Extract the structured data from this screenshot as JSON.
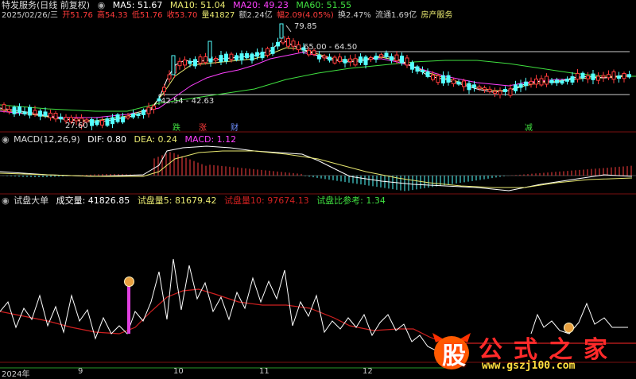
{
  "header": {
    "line1": {
      "title": "特发服务(日线 前复权)",
      "ma5": "MA5: 51.67",
      "ma10": "MA10: 51.04",
      "ma20": "MA20: 49.23",
      "ma60": "MA60: 51.55"
    },
    "line2": {
      "date": "2025/02/26/三",
      "open": "开51.76",
      "high": "高54.33",
      "low": "低51.76",
      "close": "收53.70",
      "volume": "量41827",
      "amount": "额2.24亿",
      "amplitude": "幅2.09(4.05%)",
      "turnover": "换2.47%",
      "float": "流通1.69亿",
      "sector": "房产服务"
    }
  },
  "price_panel": {
    "annotations": {
      "high_label": "79.85",
      "range_label": "65.00 - 64.50",
      "mid_label": "42.54 - 42.63",
      "low_label": "27.60"
    },
    "tags": {
      "tag1": "跌",
      "tag2": "涨",
      "tag3": "财",
      "tag4": "减"
    }
  },
  "macd_panel": {
    "title": "MACD(12,26,9)",
    "dif": "DIF: 0.80",
    "dea": "DEA: 0.24",
    "macd": "MACD: 1.12"
  },
  "indicator_panel": {
    "title": "试盘大单",
    "volume": "成交量: 41826.85",
    "test5": "试盘量5: 81679.42",
    "test10": "试盘量10: 97674.13",
    "ratio": "试盘比参考: 1.34"
  },
  "x_axis": {
    "labels": [
      "2024年",
      "9",
      "10",
      "11",
      "12"
    ]
  },
  "watermark": {
    "badge": "股",
    "chars": "公式之家",
    "url": "www.gszj100.com"
  },
  "colors": {
    "up": "#ff3b3b",
    "down": "#54ffff",
    "ma5": "#ffffff",
    "ma10": "#e8e870",
    "ma20": "#ff40ff",
    "ma60": "#40e040",
    "separator": "#7a1010"
  },
  "icons": {
    "menu": "circle-dot-icon"
  }
}
